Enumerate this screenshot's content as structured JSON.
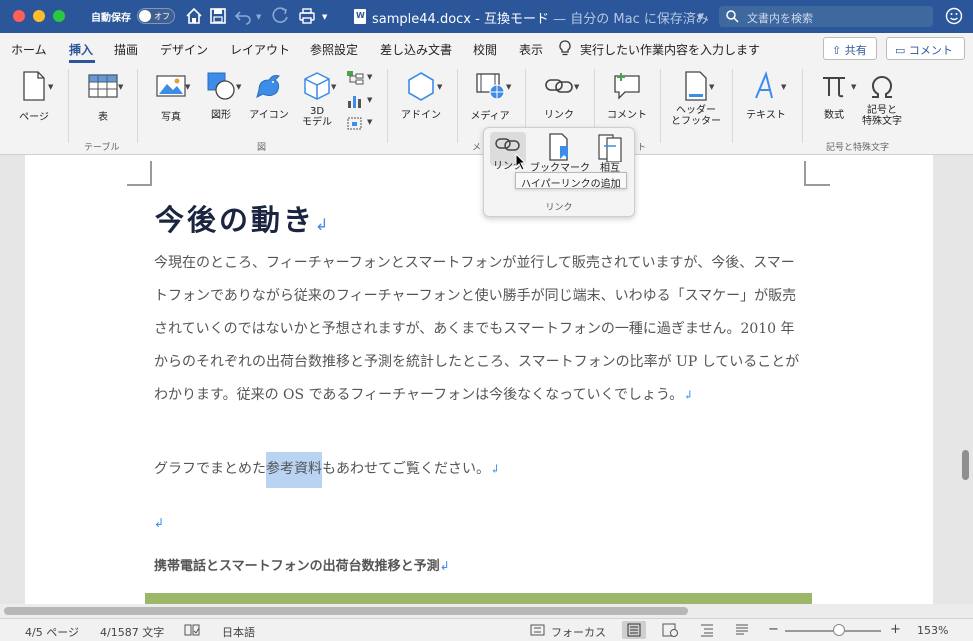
{
  "titlebar": {
    "autosave_label": "自動保存",
    "autosave_state": "オフ",
    "filename": "sample44.docx",
    "separator": " - ",
    "mode": "互換モード",
    "save_location": " — 自分の Mac に保存済み",
    "search_placeholder": "文書内を検索"
  },
  "tabs": {
    "items": [
      "ホーム",
      "挿入",
      "描画",
      "デザイン",
      "レイアウト",
      "参照設定",
      "差し込み文書",
      "校閲",
      "表示"
    ],
    "active": "挿入",
    "tell_me": "実行したい作業内容を入力します",
    "share": "共有",
    "comment": "コメント"
  },
  "ribbon": {
    "page": "ページ",
    "table": "表",
    "picture": "写真",
    "shapes": "図形",
    "icons": "アイコン",
    "model3d_1": "3D",
    "model3d_2": "モデル",
    "addins": "アドイン",
    "media": "メディア",
    "link": "リンク",
    "comment": "コメント",
    "header_footer_1": "ヘッダー",
    "header_footer_2": "とフッター",
    "text": "テキスト",
    "equation": "数式",
    "symbols_1": "記号と",
    "symbols_2": "特殊文字",
    "group_table": "テーブル",
    "group_illustrations": "図",
    "group_media_partial": "メ",
    "group_comment_partial": "ト",
    "group_symbols": "記号と特殊文字"
  },
  "dropdown": {
    "link": "リンク",
    "bookmark": "ブックマーク",
    "crossref": "相互",
    "group_label": "リンク",
    "tooltip": "ハイパーリンクの追加"
  },
  "document": {
    "heading": "今後の動き",
    "paragraph": "今現在のところ、フィーチャーフォンとスマートフォンが並行して販売されていますが、今後、スマートフォンでありながら従来のフィーチャーフォンと使い勝手が同じ端末、いわゆる「スマケー」が販売されていくのではないかと予想されますが、あくまでもスマートフォンの一種に過ぎません。2010 年からのそれぞれの出荷台数推移と予測を統計したところ、スマートフォンの比率が UP していることがわかります。従来の OS であるフィーチャーフォンは今後なくなっていくでしょう。",
    "para2_before": "グラフでまとめた",
    "para2_selected": "参考資料",
    "para2_after": "もあわせてご覧ください。",
    "subheading": "携帯電話とスマートフォンの出荷台数推移と予測",
    "return_mark": "↲"
  },
  "status": {
    "page": "4/5 ページ",
    "words": "4/1587 文字",
    "language": "日本語",
    "focus": "フォーカス",
    "zoom": "153%"
  },
  "colors": {
    "titlebar": "#2b579a",
    "selection": "#b9d4f3",
    "table_header": "#9bb76a"
  }
}
